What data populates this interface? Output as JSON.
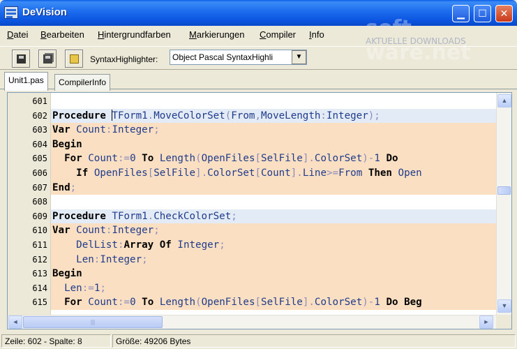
{
  "window": {
    "title": "DeVision",
    "watermark": "soft-ware.net",
    "watermark_sub": "AKTUELLE DOWNLOADS"
  },
  "menu": [
    "Datei",
    "Bearbeiten",
    "Hintergrundfarben",
    "Markierungen",
    "Compiler",
    "Info"
  ],
  "toolbar": {
    "highlighter_label": "SyntaxHighlighter:",
    "highlighter_value": "Object Pascal SyntaxHighli",
    "buttons": [
      "save-icon",
      "save-all-icon",
      "compile-icon"
    ]
  },
  "tabs": [
    "Unit1.pas",
    "CompilerInfo"
  ],
  "editor": {
    "lines": [
      {
        "n": "601",
        "bg": "white",
        "tokens": []
      },
      {
        "n": "602",
        "bg": "blue",
        "tokens": [
          [
            "kw",
            "Procedure"
          ],
          [
            "t",
            " "
          ],
          [
            "id",
            "TForm1"
          ],
          [
            "sym",
            "."
          ],
          [
            "id",
            "MoveColorSet"
          ],
          [
            "sym",
            "("
          ],
          [
            "id",
            "From"
          ],
          [
            "sym",
            ","
          ],
          [
            "id",
            "MoveLength"
          ],
          [
            "sym",
            ":"
          ],
          [
            "id",
            "Integer"
          ],
          [
            "sym",
            ");"
          ]
        ]
      },
      {
        "n": "603",
        "bg": "orange",
        "tokens": [
          [
            "kw",
            "Var"
          ],
          [
            "t",
            " "
          ],
          [
            "id",
            "Count"
          ],
          [
            "sym",
            ":"
          ],
          [
            "id",
            "Integer"
          ],
          [
            "sym",
            ";"
          ]
        ]
      },
      {
        "n": "604",
        "bg": "orange",
        "tokens": [
          [
            "kw",
            "Begin"
          ]
        ]
      },
      {
        "n": "605",
        "bg": "orange",
        "tokens": [
          [
            "t",
            "  "
          ],
          [
            "kw",
            "For"
          ],
          [
            "t",
            " "
          ],
          [
            "id",
            "Count"
          ],
          [
            "sym",
            ":="
          ],
          [
            "num",
            "0"
          ],
          [
            "t",
            " "
          ],
          [
            "kw",
            "To"
          ],
          [
            "t",
            " "
          ],
          [
            "id",
            "Length"
          ],
          [
            "sym",
            "("
          ],
          [
            "id",
            "OpenFiles"
          ],
          [
            "sym",
            "["
          ],
          [
            "id",
            "SelFile"
          ],
          [
            "sym",
            "]."
          ],
          [
            "id",
            "ColorSet"
          ],
          [
            "sym",
            ")-"
          ],
          [
            "num",
            "1"
          ],
          [
            "t",
            " "
          ],
          [
            "kw",
            "Do"
          ]
        ]
      },
      {
        "n": "606",
        "bg": "orange",
        "tokens": [
          [
            "t",
            "    "
          ],
          [
            "kw",
            "If"
          ],
          [
            "t",
            " "
          ],
          [
            "id",
            "OpenFiles"
          ],
          [
            "sym",
            "["
          ],
          [
            "id",
            "SelFile"
          ],
          [
            "sym",
            "]."
          ],
          [
            "id",
            "ColorSet"
          ],
          [
            "sym",
            "["
          ],
          [
            "id",
            "Count"
          ],
          [
            "sym",
            "]."
          ],
          [
            "id",
            "Line"
          ],
          [
            "sym",
            ">="
          ],
          [
            "id",
            "From"
          ],
          [
            "t",
            " "
          ],
          [
            "kw",
            "Then"
          ],
          [
            "t",
            " "
          ],
          [
            "id",
            "Open"
          ]
        ]
      },
      {
        "n": "607",
        "bg": "orange",
        "tokens": [
          [
            "kw",
            "End"
          ],
          [
            "sym",
            ";"
          ]
        ]
      },
      {
        "n": "608",
        "bg": "white",
        "tokens": []
      },
      {
        "n": "609",
        "bg": "blue",
        "tokens": [
          [
            "kw",
            "Procedure"
          ],
          [
            "t",
            " "
          ],
          [
            "id",
            "TForm1"
          ],
          [
            "sym",
            "."
          ],
          [
            "id",
            "CheckColorSet"
          ],
          [
            "sym",
            ";"
          ]
        ]
      },
      {
        "n": "610",
        "bg": "orange",
        "tokens": [
          [
            "kw",
            "Var"
          ],
          [
            "t",
            " "
          ],
          [
            "id",
            "Count"
          ],
          [
            "sym",
            ":"
          ],
          [
            "id",
            "Integer"
          ],
          [
            "sym",
            ";"
          ]
        ]
      },
      {
        "n": "611",
        "bg": "orange",
        "tokens": [
          [
            "t",
            "    "
          ],
          [
            "id",
            "DelList"
          ],
          [
            "sym",
            ":"
          ],
          [
            "kw",
            "Array Of"
          ],
          [
            "t",
            " "
          ],
          [
            "id",
            "Integer"
          ],
          [
            "sym",
            ";"
          ]
        ]
      },
      {
        "n": "612",
        "bg": "orange",
        "tokens": [
          [
            "t",
            "    "
          ],
          [
            "id",
            "Len"
          ],
          [
            "sym",
            ":"
          ],
          [
            "id",
            "Integer"
          ],
          [
            "sym",
            ";"
          ]
        ]
      },
      {
        "n": "613",
        "bg": "orange",
        "tokens": [
          [
            "kw",
            "Begin"
          ]
        ]
      },
      {
        "n": "614",
        "bg": "orange",
        "tokens": [
          [
            "t",
            "  "
          ],
          [
            "id",
            "Len"
          ],
          [
            "sym",
            ":="
          ],
          [
            "num",
            "1"
          ],
          [
            "sym",
            ";"
          ]
        ]
      },
      {
        "n": "615",
        "bg": "orange",
        "tokens": [
          [
            "t",
            "  "
          ],
          [
            "kw",
            "For"
          ],
          [
            "t",
            " "
          ],
          [
            "id",
            "Count"
          ],
          [
            "sym",
            ":="
          ],
          [
            "num",
            "0"
          ],
          [
            "t",
            " "
          ],
          [
            "kw",
            "To"
          ],
          [
            "t",
            " "
          ],
          [
            "id",
            "Length"
          ],
          [
            "sym",
            "("
          ],
          [
            "id",
            "OpenFiles"
          ],
          [
            "sym",
            "["
          ],
          [
            "id",
            "SelFile"
          ],
          [
            "sym",
            "]."
          ],
          [
            "id",
            "ColorSet"
          ],
          [
            "sym",
            ")-"
          ],
          [
            "num",
            "1"
          ],
          [
            "t",
            " "
          ],
          [
            "kw",
            "Do Beg"
          ]
        ]
      }
    ]
  },
  "status": {
    "position": "Zeile: 602 - Spalte: 8",
    "size": "Größe: 49206 Bytes"
  },
  "scroll": {
    "up": "▲",
    "down": "▼",
    "left": "◄",
    "right": "►",
    "grip": "|||"
  }
}
